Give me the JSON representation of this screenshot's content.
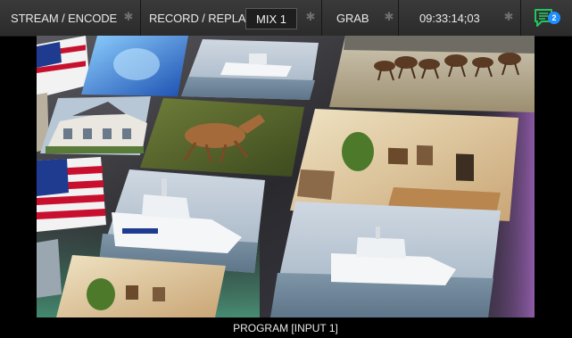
{
  "toolbar": {
    "stream_label": "STREAM / ENCODE",
    "record_label": "RECORD / REPLAY",
    "mix_label": "MIX 1",
    "grab_label": "GRAB",
    "timecode": "09:33:14;03",
    "notification_count": "2",
    "gear_icon": "gear-icon",
    "chat_icon": "chat-icon"
  },
  "viewer": {
    "output_label": "PROGRAM [INPUT 1]"
  },
  "colors": {
    "toolbar_bg": "#333333",
    "chat_green": "#22c55e",
    "badge_blue": "#1f8fff"
  }
}
